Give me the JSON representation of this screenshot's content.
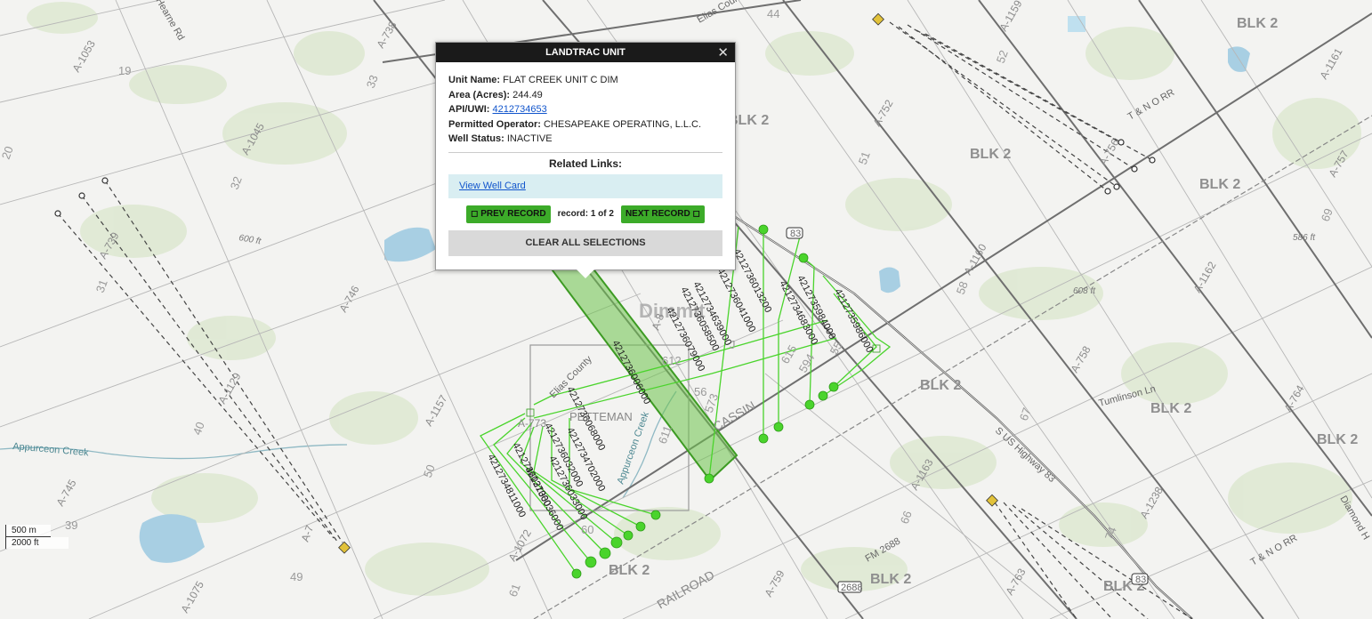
{
  "popup": {
    "title": "LANDTRAC UNIT",
    "close_icon": "✕",
    "fields": [
      {
        "label": "Unit Name:",
        "value": "FLAT CREEK UNIT C DIM"
      },
      {
        "label": "Area (Acres):",
        "value": "244.49"
      },
      {
        "label": "API/UWI:",
        "value": "4212734653",
        "is_link": true
      },
      {
        "label": "Permitted Operator:",
        "value": "CHESAPEAKE OPERATING, L.L.C."
      },
      {
        "label": "Well Status:",
        "value": "INACTIVE"
      }
    ],
    "related_links_title": "Related Links:",
    "view_well_card": "View Well Card",
    "prev_record": "◻ PREV RECORD",
    "record_status": "record: 1 of 2",
    "next_record": "NEXT RECORD ◻",
    "clear_all": "CLEAR ALL SELECTIONS"
  },
  "map": {
    "county_name": "Dimmit",
    "block_labels": [
      "BLK 2",
      "BLK 2",
      "BLK 2",
      "BLK 2",
      "BLK 2",
      "BLK 2",
      "BLK 2",
      "BLK 2",
      "BLK 2",
      "BLK 2",
      "BLK 2"
    ],
    "section_numbers": [
      "19",
      "33",
      "20",
      "32",
      "31",
      "40",
      "39",
      "49",
      "44",
      "52",
      "51",
      "58",
      "67",
      "66",
      "74",
      "69",
      "50",
      "61",
      "60",
      "56",
      "55",
      "54",
      "J",
      "623",
      "615",
      "612",
      "611",
      "594",
      "573",
      "60",
      "61"
    ],
    "abstracts": [
      "A-1053",
      "A-738",
      "A-1045",
      "A-739",
      "A-1129",
      "A-745",
      "A-1075",
      "A-746",
      "A-1157",
      "A-1072",
      "A-1159",
      "A-752",
      "A-1160",
      "A-1162",
      "A-756",
      "A-757",
      "A-1161",
      "A-758",
      "A-764",
      "A-1163",
      "A-1238",
      "A-763",
      "A-759",
      "A-8",
      "A-66",
      "A-773",
      "A-655",
      "A-657",
      "A-7"
    ],
    "elevations": [
      "600 ft",
      "586 ft",
      "608 ft"
    ],
    "places": [
      "PETTEMAN",
      "CASSIN",
      "RAILROAD"
    ],
    "roads": [
      "Hearne Rd",
      "Elias County",
      "Elias County",
      "Tumlinson Ln",
      "S US Highway 83",
      "T & N O RR",
      "T & N O RR",
      "FM 2688",
      "Diamond H",
      "83",
      "83",
      "2688"
    ],
    "water": [
      "Appurceon Creek",
      "Appurceon Creek"
    ],
    "api_labels": [
      "4212736006000",
      "4212736013200",
      "4212736041000",
      "4212734639000",
      "4212736058500",
      "4212736079000",
      "4212734683000",
      "4212735984000",
      "4212735986000",
      "4212736068000",
      "4212734702000",
      "4212736032000",
      "4212736033000",
      "4212736031000",
      "4212736036000",
      "4212734811000"
    ],
    "scale": {
      "metric": "500 m",
      "imperial": "2000 ft"
    },
    "colors": {
      "well_path": "#4ad42c",
      "selected_unit": "#57b83a",
      "road": "#666666"
    }
  }
}
